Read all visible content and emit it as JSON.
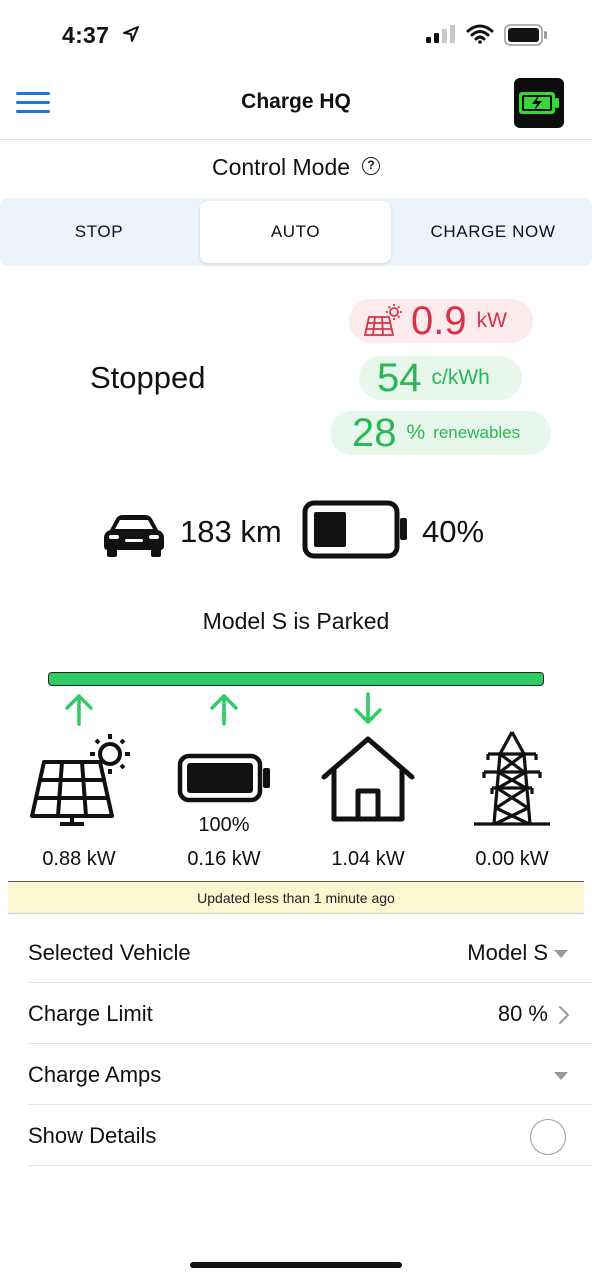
{
  "status_bar": {
    "time": "4:37"
  },
  "nav": {
    "title": "Charge HQ"
  },
  "control_mode": {
    "title": "Control Mode",
    "help": "?",
    "options": [
      "STOP",
      "AUTO",
      "CHARGE NOW"
    ],
    "selected": "AUTO"
  },
  "charger": {
    "state": "Stopped"
  },
  "metrics": {
    "solar_value": "0.9",
    "solar_unit": "kW",
    "price_value": "54",
    "price_unit": "c/kWh",
    "renew_value": "28",
    "renew_unit": "%",
    "renew_label": "renewables"
  },
  "vehicle": {
    "range": "183 km",
    "soc": "40%",
    "status": "Model S is Parked"
  },
  "energy_flow": {
    "nodes": [
      {
        "name": "solar",
        "value": "0.88 kW",
        "direction": "up"
      },
      {
        "name": "battery",
        "value": "0.16 kW",
        "sub": "100%",
        "direction": "up"
      },
      {
        "name": "home",
        "value": "1.04 kW",
        "direction": "down"
      },
      {
        "name": "grid",
        "value": "0.00 kW",
        "direction": "none"
      }
    ],
    "updated": "Updated less than 1 minute ago"
  },
  "settings": {
    "selected_vehicle_label": "Selected Vehicle",
    "selected_vehicle_value": "Model S",
    "charge_limit_label": "Charge Limit",
    "charge_limit_value": "80 %",
    "charge_amps_label": "Charge Amps",
    "show_details_label": "Show Details"
  },
  "colors": {
    "accent_blue": "#1e73e8",
    "solar_red": "#d6334a",
    "green": "#2bb757",
    "flow_green": "#2ecc65",
    "updated_bg": "#fbf7d0"
  }
}
